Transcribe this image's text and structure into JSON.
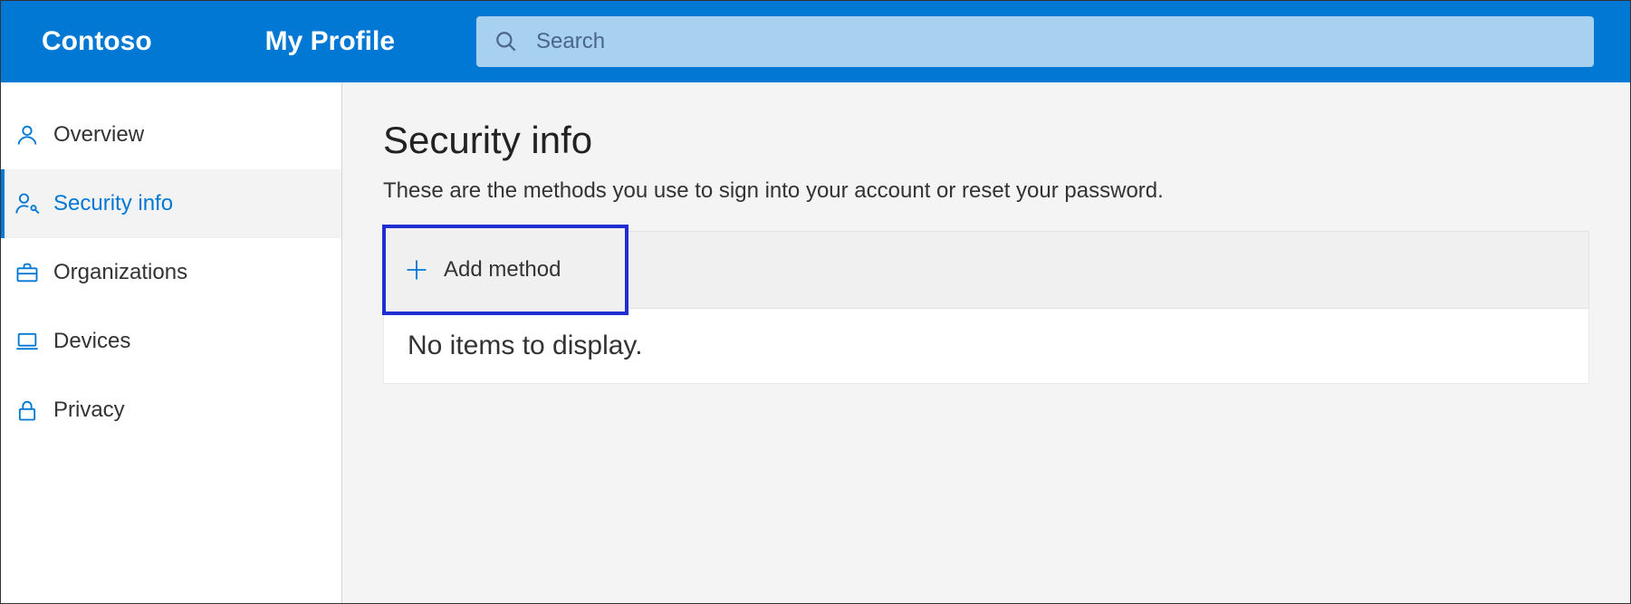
{
  "header": {
    "brand": "Contoso",
    "section": "My Profile",
    "search_placeholder": "Search"
  },
  "sidebar": {
    "items": [
      {
        "label": "Overview",
        "icon": "person-icon"
      },
      {
        "label": "Security info",
        "icon": "person-key-icon"
      },
      {
        "label": "Organizations",
        "icon": "briefcase-icon"
      },
      {
        "label": "Devices",
        "icon": "laptop-icon"
      },
      {
        "label": "Privacy",
        "icon": "lock-icon"
      }
    ]
  },
  "main": {
    "title": "Security info",
    "description": "These are the methods you use to sign into your account or reset your password.",
    "add_method_label": "Add method",
    "empty_message": "No items to display."
  }
}
